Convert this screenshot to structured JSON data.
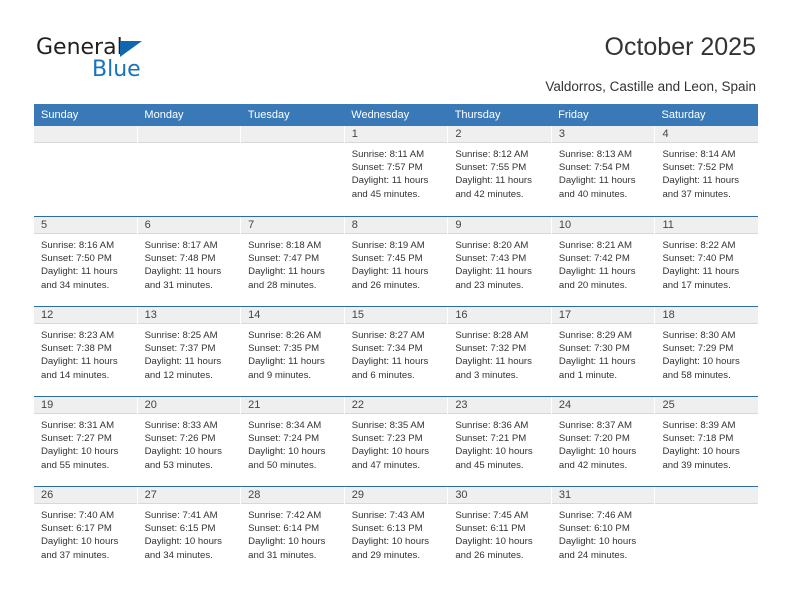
{
  "brand": {
    "name_part1": "General",
    "name_part2": "Blue",
    "accent_color": "#1874bd"
  },
  "header": {
    "title": "October 2025",
    "subtitle": "Valdorros, Castille and Leon, Spain"
  },
  "calendar": {
    "header_color": "#3a79b8",
    "weekdays": [
      "Sunday",
      "Monday",
      "Tuesday",
      "Wednesday",
      "Thursday",
      "Friday",
      "Saturday"
    ],
    "weeks": [
      [
        {
          "day": "",
          "sunrise": "",
          "sunset": "",
          "daylight1": "",
          "daylight2": ""
        },
        {
          "day": "",
          "sunrise": "",
          "sunset": "",
          "daylight1": "",
          "daylight2": ""
        },
        {
          "day": "",
          "sunrise": "",
          "sunset": "",
          "daylight1": "",
          "daylight2": ""
        },
        {
          "day": "1",
          "sunrise": "Sunrise: 8:11 AM",
          "sunset": "Sunset: 7:57 PM",
          "daylight1": "Daylight: 11 hours",
          "daylight2": "and 45 minutes."
        },
        {
          "day": "2",
          "sunrise": "Sunrise: 8:12 AM",
          "sunset": "Sunset: 7:55 PM",
          "daylight1": "Daylight: 11 hours",
          "daylight2": "and 42 minutes."
        },
        {
          "day": "3",
          "sunrise": "Sunrise: 8:13 AM",
          "sunset": "Sunset: 7:54 PM",
          "daylight1": "Daylight: 11 hours",
          "daylight2": "and 40 minutes."
        },
        {
          "day": "4",
          "sunrise": "Sunrise: 8:14 AM",
          "sunset": "Sunset: 7:52 PM",
          "daylight1": "Daylight: 11 hours",
          "daylight2": "and 37 minutes."
        }
      ],
      [
        {
          "day": "5",
          "sunrise": "Sunrise: 8:16 AM",
          "sunset": "Sunset: 7:50 PM",
          "daylight1": "Daylight: 11 hours",
          "daylight2": "and 34 minutes."
        },
        {
          "day": "6",
          "sunrise": "Sunrise: 8:17 AM",
          "sunset": "Sunset: 7:48 PM",
          "daylight1": "Daylight: 11 hours",
          "daylight2": "and 31 minutes."
        },
        {
          "day": "7",
          "sunrise": "Sunrise: 8:18 AM",
          "sunset": "Sunset: 7:47 PM",
          "daylight1": "Daylight: 11 hours",
          "daylight2": "and 28 minutes."
        },
        {
          "day": "8",
          "sunrise": "Sunrise: 8:19 AM",
          "sunset": "Sunset: 7:45 PM",
          "daylight1": "Daylight: 11 hours",
          "daylight2": "and 26 minutes."
        },
        {
          "day": "9",
          "sunrise": "Sunrise: 8:20 AM",
          "sunset": "Sunset: 7:43 PM",
          "daylight1": "Daylight: 11 hours",
          "daylight2": "and 23 minutes."
        },
        {
          "day": "10",
          "sunrise": "Sunrise: 8:21 AM",
          "sunset": "Sunset: 7:42 PM",
          "daylight1": "Daylight: 11 hours",
          "daylight2": "and 20 minutes."
        },
        {
          "day": "11",
          "sunrise": "Sunrise: 8:22 AM",
          "sunset": "Sunset: 7:40 PM",
          "daylight1": "Daylight: 11 hours",
          "daylight2": "and 17 minutes."
        }
      ],
      [
        {
          "day": "12",
          "sunrise": "Sunrise: 8:23 AM",
          "sunset": "Sunset: 7:38 PM",
          "daylight1": "Daylight: 11 hours",
          "daylight2": "and 14 minutes."
        },
        {
          "day": "13",
          "sunrise": "Sunrise: 8:25 AM",
          "sunset": "Sunset: 7:37 PM",
          "daylight1": "Daylight: 11 hours",
          "daylight2": "and 12 minutes."
        },
        {
          "day": "14",
          "sunrise": "Sunrise: 8:26 AM",
          "sunset": "Sunset: 7:35 PM",
          "daylight1": "Daylight: 11 hours",
          "daylight2": "and 9 minutes."
        },
        {
          "day": "15",
          "sunrise": "Sunrise: 8:27 AM",
          "sunset": "Sunset: 7:34 PM",
          "daylight1": "Daylight: 11 hours",
          "daylight2": "and 6 minutes."
        },
        {
          "day": "16",
          "sunrise": "Sunrise: 8:28 AM",
          "sunset": "Sunset: 7:32 PM",
          "daylight1": "Daylight: 11 hours",
          "daylight2": "and 3 minutes."
        },
        {
          "day": "17",
          "sunrise": "Sunrise: 8:29 AM",
          "sunset": "Sunset: 7:30 PM",
          "daylight1": "Daylight: 11 hours",
          "daylight2": "and 1 minute."
        },
        {
          "day": "18",
          "sunrise": "Sunrise: 8:30 AM",
          "sunset": "Sunset: 7:29 PM",
          "daylight1": "Daylight: 10 hours",
          "daylight2": "and 58 minutes."
        }
      ],
      [
        {
          "day": "19",
          "sunrise": "Sunrise: 8:31 AM",
          "sunset": "Sunset: 7:27 PM",
          "daylight1": "Daylight: 10 hours",
          "daylight2": "and 55 minutes."
        },
        {
          "day": "20",
          "sunrise": "Sunrise: 8:33 AM",
          "sunset": "Sunset: 7:26 PM",
          "daylight1": "Daylight: 10 hours",
          "daylight2": "and 53 minutes."
        },
        {
          "day": "21",
          "sunrise": "Sunrise: 8:34 AM",
          "sunset": "Sunset: 7:24 PM",
          "daylight1": "Daylight: 10 hours",
          "daylight2": "and 50 minutes."
        },
        {
          "day": "22",
          "sunrise": "Sunrise: 8:35 AM",
          "sunset": "Sunset: 7:23 PM",
          "daylight1": "Daylight: 10 hours",
          "daylight2": "and 47 minutes."
        },
        {
          "day": "23",
          "sunrise": "Sunrise: 8:36 AM",
          "sunset": "Sunset: 7:21 PM",
          "daylight1": "Daylight: 10 hours",
          "daylight2": "and 45 minutes."
        },
        {
          "day": "24",
          "sunrise": "Sunrise: 8:37 AM",
          "sunset": "Sunset: 7:20 PM",
          "daylight1": "Daylight: 10 hours",
          "daylight2": "and 42 minutes."
        },
        {
          "day": "25",
          "sunrise": "Sunrise: 8:39 AM",
          "sunset": "Sunset: 7:18 PM",
          "daylight1": "Daylight: 10 hours",
          "daylight2": "and 39 minutes."
        }
      ],
      [
        {
          "day": "26",
          "sunrise": "Sunrise: 7:40 AM",
          "sunset": "Sunset: 6:17 PM",
          "daylight1": "Daylight: 10 hours",
          "daylight2": "and 37 minutes."
        },
        {
          "day": "27",
          "sunrise": "Sunrise: 7:41 AM",
          "sunset": "Sunset: 6:15 PM",
          "daylight1": "Daylight: 10 hours",
          "daylight2": "and 34 minutes."
        },
        {
          "day": "28",
          "sunrise": "Sunrise: 7:42 AM",
          "sunset": "Sunset: 6:14 PM",
          "daylight1": "Daylight: 10 hours",
          "daylight2": "and 31 minutes."
        },
        {
          "day": "29",
          "sunrise": "Sunrise: 7:43 AM",
          "sunset": "Sunset: 6:13 PM",
          "daylight1": "Daylight: 10 hours",
          "daylight2": "and 29 minutes."
        },
        {
          "day": "30",
          "sunrise": "Sunrise: 7:45 AM",
          "sunset": "Sunset: 6:11 PM",
          "daylight1": "Daylight: 10 hours",
          "daylight2": "and 26 minutes."
        },
        {
          "day": "31",
          "sunrise": "Sunrise: 7:46 AM",
          "sunset": "Sunset: 6:10 PM",
          "daylight1": "Daylight: 10 hours",
          "daylight2": "and 24 minutes."
        },
        {
          "day": "",
          "sunrise": "",
          "sunset": "",
          "daylight1": "",
          "daylight2": ""
        }
      ]
    ]
  }
}
